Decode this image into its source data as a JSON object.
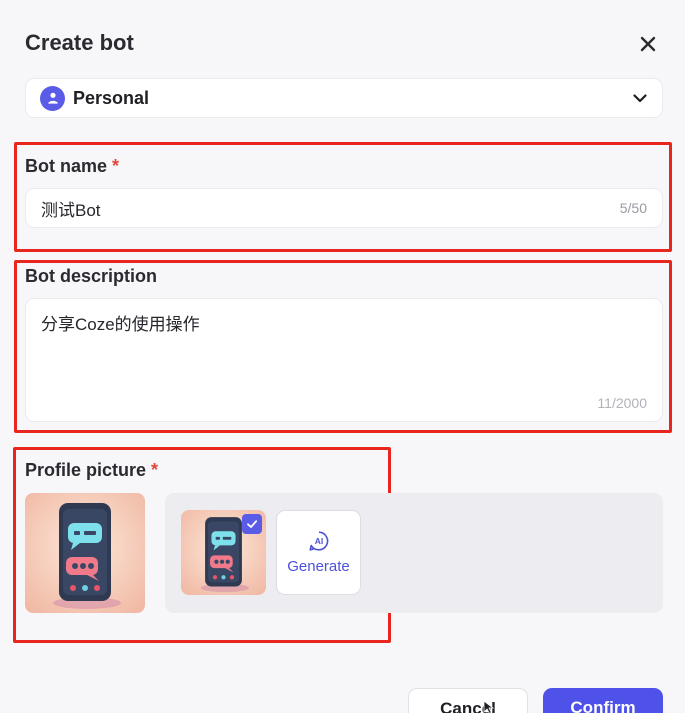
{
  "dialog": {
    "title": "Create bot",
    "close_icon": "close-icon"
  },
  "space": {
    "label": "Personal",
    "icon": "user-icon",
    "chevron_icon": "chevron-down-icon"
  },
  "bot_name": {
    "label": "Bot name",
    "required_mark": "*",
    "value": "测试Bot",
    "counter": "5/50"
  },
  "bot_description": {
    "label": "Bot description",
    "value": "分享Coze的使用操作",
    "counter": "11/2000"
  },
  "profile_picture": {
    "label": "Profile picture",
    "required_mark": "*",
    "generate_label": "Generate",
    "ai_icon": "ai-icon",
    "selected_check_icon": "check-icon"
  },
  "footer": {
    "cancel_label": "Cancel",
    "confirm_label": "Confirm"
  },
  "colors": {
    "accent": "#4e52e8",
    "highlight_box": "#e8261f",
    "required": "#e2463b"
  }
}
